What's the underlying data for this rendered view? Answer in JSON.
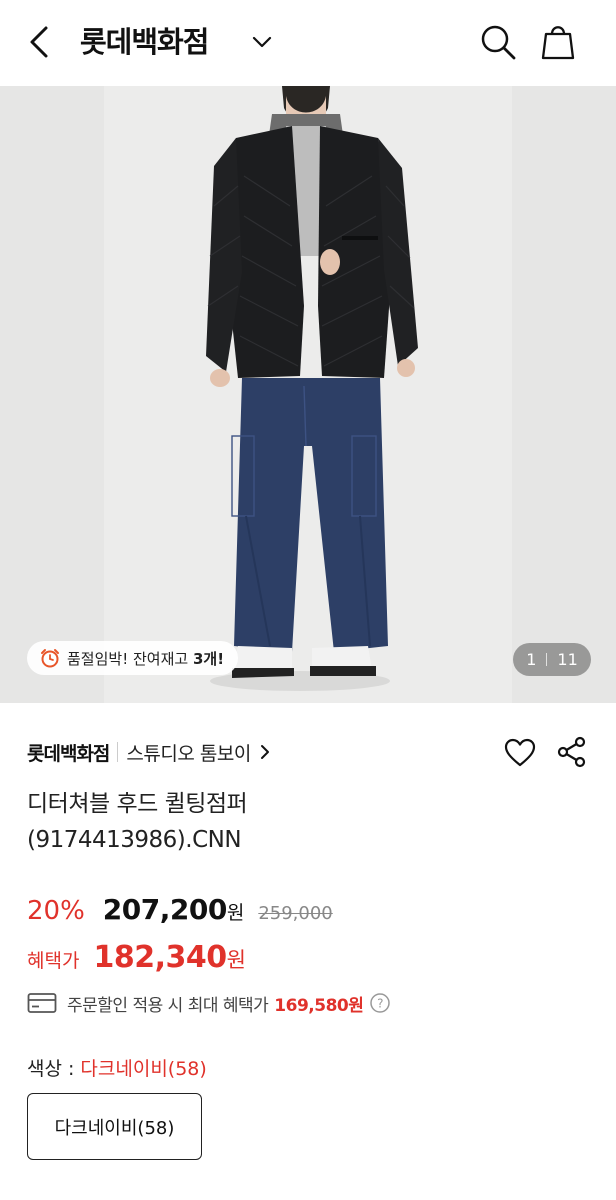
{
  "header": {
    "title": "롯데백화점",
    "icons": [
      "back-icon",
      "chevron-down-icon",
      "search-icon",
      "shopping-bag-icon"
    ]
  },
  "gallery": {
    "stock_prefix": "품절임박! 잔여재고 ",
    "stock_count": "3개!",
    "current_page": "1",
    "total_pages": "11"
  },
  "product": {
    "brand": "롯데백화점",
    "store": "스튜디오 톰보이",
    "name_line1": "디터쳐블 후드 퀼팅점퍼",
    "name_line2": "(9174413986).CNN",
    "discount_rate": "20%",
    "sale_price": "207,200",
    "currency": "원",
    "original_price": "259,000",
    "benefit_label": "혜택가",
    "benefit_price": "182,340",
    "max_benefit_text": "주문할인 적용 시 최대 혜택가",
    "max_benefit_price": "169,580원",
    "color_label": "색상 :",
    "color_value": "다크네이비(58)",
    "option": "다크네이비(58)"
  },
  "colors": {
    "accent_red": "#e0322b",
    "text_dark": "#111111"
  }
}
